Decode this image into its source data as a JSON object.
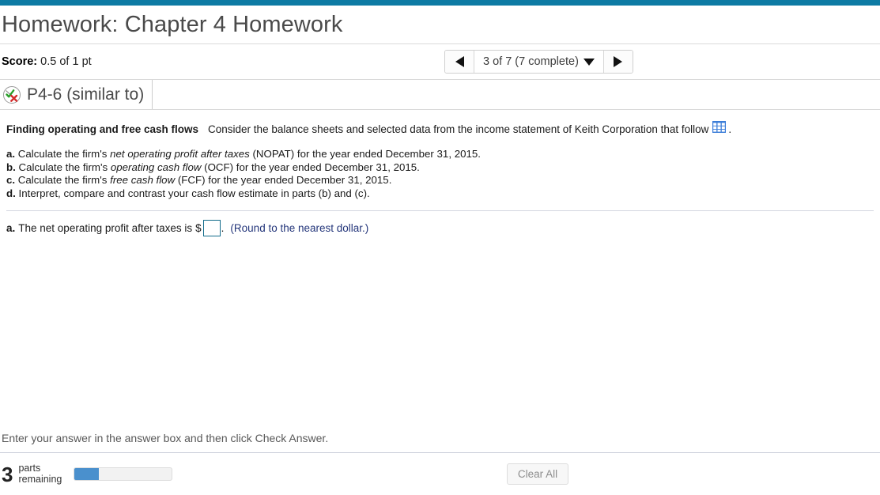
{
  "theme": {
    "top_bar_color": "#0e7ba4",
    "accent_blue": "#4a90cd",
    "link_blue": "#23357a",
    "input_border": "#116a8a",
    "table_icon_color": "#3b7dd8"
  },
  "header": {
    "title": "Homework: Chapter 4 Homework",
    "score_label": "Score:",
    "score_value": "0.5 of 1 pt"
  },
  "navigation": {
    "prev_icon": "triangle-left-icon",
    "next_icon": "triangle-right-icon",
    "dropdown_icon": "caret-down-icon",
    "label": "3 of 7 (7 complete)",
    "current": 3,
    "total": 7,
    "complete": 7
  },
  "problem": {
    "status_icon": "check-and-cross-icon",
    "id_label": "P4-6 (similar to)"
  },
  "question": {
    "topic": "Finding operating and free cash flows",
    "stem_before_icon": "Consider the balance sheets and selected data from the income statement of Keith Corporation that follow",
    "data_table_icon": "table-grid-icon",
    "stem_after_icon": ".",
    "parts": [
      {
        "letter": "a.",
        "text_before_italic": "Calculate the firm's ",
        "italic": "net operating profit after taxes",
        "text_after_italic": " (NOPAT) for the year ended December 31, 2015."
      },
      {
        "letter": "b.",
        "text_before_italic": "Calculate the firm's ",
        "italic": "operating cash flow",
        "text_after_italic": " (OCF) for the year ended December 31, 2015."
      },
      {
        "letter": "c.",
        "text_before_italic": "Calculate the firm's ",
        "italic": "free cash flow",
        "text_after_italic": " (FCF) for the year ended December 31, 2015."
      },
      {
        "letter": "d.",
        "text_before_italic": "Interpret, compare and contrast your cash flow estimate in parts (b) and (c).",
        "italic": "",
        "text_after_italic": ""
      }
    ]
  },
  "answer": {
    "letter": "a.",
    "prompt": "The net operating profit after taxes is",
    "currency_symbol": "$",
    "input_value": "",
    "input_placeholder": "",
    "period": ".",
    "rounding_note": "(Round to the nearest dollar.)"
  },
  "footer": {
    "hint": "Enter your answer in the answer box and then click Check Answer.",
    "parts_remaining_count": "3",
    "parts_remaining_label_line1": "parts",
    "parts_remaining_label_line2": "remaining",
    "progress_percent": 25,
    "clear_all_label": "Clear All"
  }
}
